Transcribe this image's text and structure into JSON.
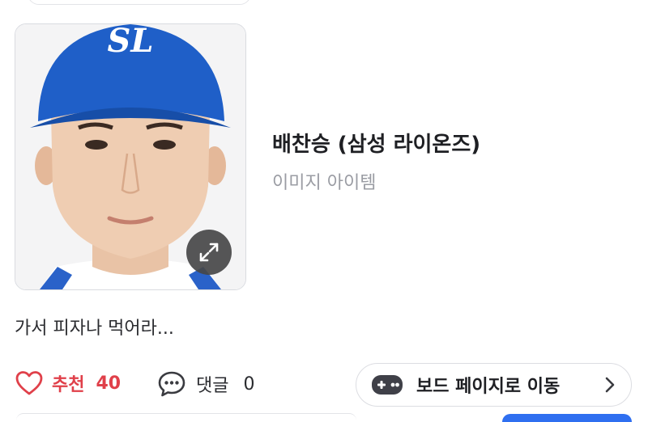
{
  "item": {
    "title": "배찬승 (삼성 라이온즈)",
    "subtitle": "이미지 아이템",
    "image_alt": "baseball player portrait",
    "expand_icon": "expand-arrows-icon"
  },
  "post": {
    "text": "가서 피자나 먹어라..."
  },
  "actions": {
    "like_label": "추천",
    "like_count": "40",
    "like_icon": "heart-outline-icon",
    "like_color": "#e0404a",
    "comment_label": "댓글",
    "comment_count": "0",
    "comment_icon": "speech-bubble-icon"
  },
  "board_button": {
    "label": "보드 페이지로 이동",
    "icon": "gamepad-icon",
    "chevron": "chevron-right-icon"
  },
  "colors": {
    "accent": "#2f6ff0",
    "cap_blue": "#1f5fc8"
  }
}
